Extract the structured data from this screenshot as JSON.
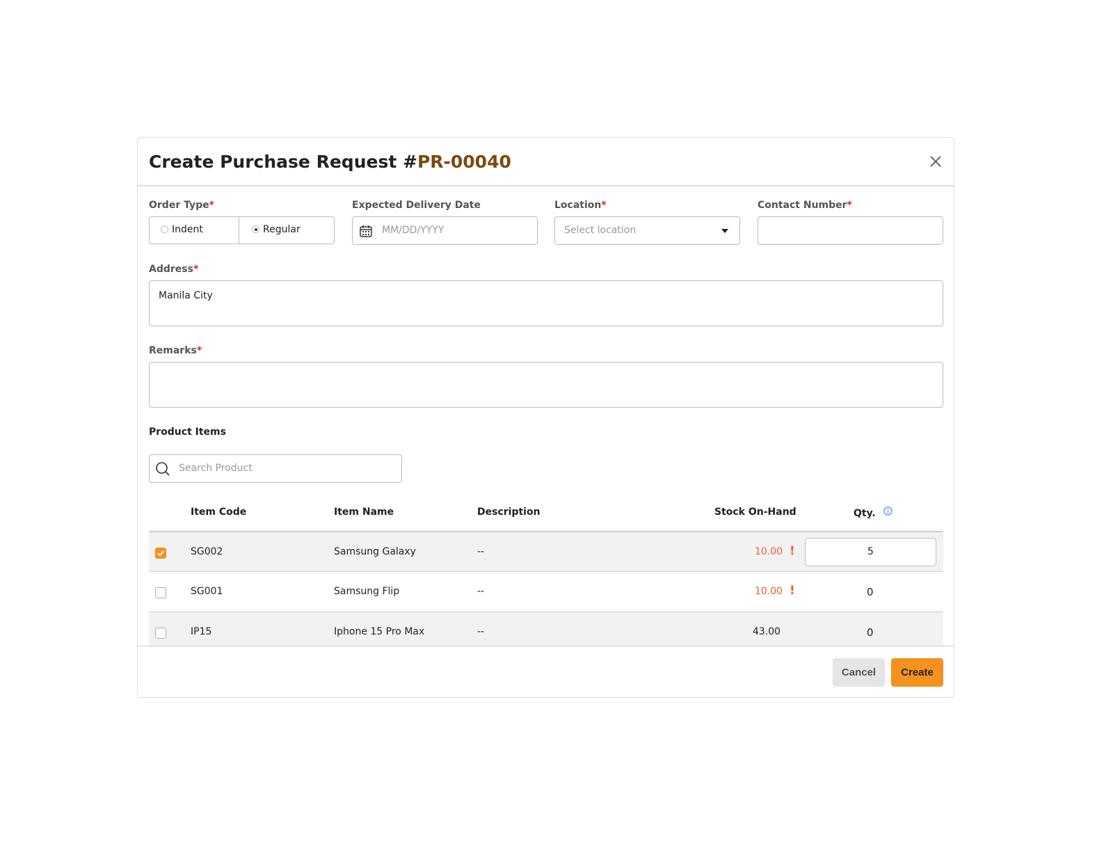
{
  "dialog": {
    "title": "Create Purchase Request #",
    "number": "PR-00040"
  },
  "colors": {
    "accent": "#f5921e",
    "number": "#7a4a0c",
    "warning": "#e8622a",
    "required": "#e02020",
    "info": "#3b82f6"
  },
  "form": {
    "order_type": {
      "label": "Order Type",
      "options": [
        "Indent",
        "Regular"
      ],
      "selected": "Regular"
    },
    "delivery_date": {
      "label": "Expected Delivery Date",
      "placeholder": "MM/DD/YYYY"
    },
    "location": {
      "label": "Location",
      "placeholder": "Select location"
    },
    "contact": {
      "label": "Contact Number",
      "value": ""
    },
    "address": {
      "label": "Address",
      "value": "Manila City"
    },
    "remarks": {
      "label": "Remarks",
      "value": ""
    },
    "required_mark": "*"
  },
  "products": {
    "title": "Product Items",
    "search_placeholder": "Search Product",
    "columns": [
      "Item Code",
      "Item Name",
      "Description",
      "Stock On-Hand",
      "Qty."
    ],
    "rows": [
      {
        "checked": true,
        "code": "SG002",
        "name": "Samsung Galaxy",
        "description": "--",
        "stock": "10.00",
        "low": true,
        "qty": "5"
      },
      {
        "checked": false,
        "code": "SG001",
        "name": "Samsung Flip",
        "description": "--",
        "stock": "10.00",
        "low": true,
        "qty": "0"
      },
      {
        "checked": false,
        "code": "IP15",
        "name": "Iphone 15 Pro Max",
        "description": "--",
        "stock": "43.00",
        "low": false,
        "qty": "0"
      }
    ],
    "warn_mark": "!"
  },
  "footer": {
    "cancel": "Cancel",
    "create": "Create"
  }
}
